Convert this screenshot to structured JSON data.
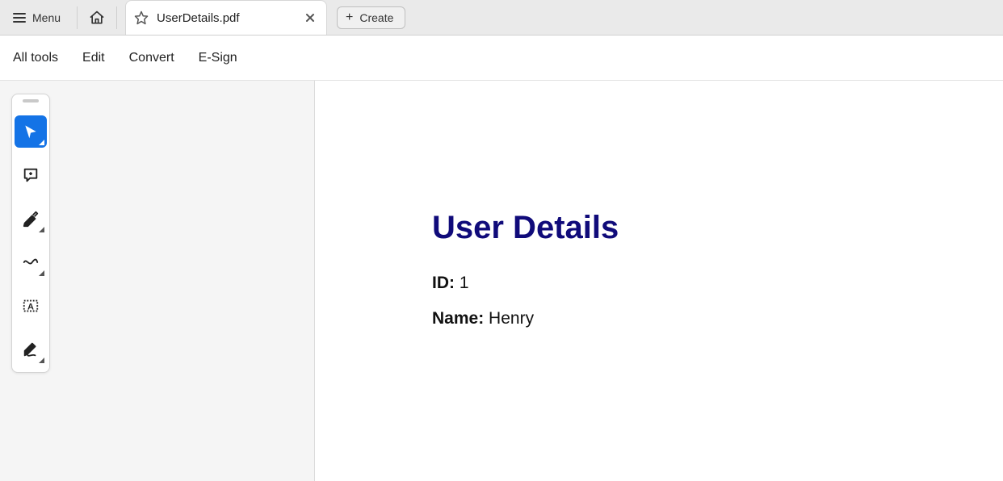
{
  "topbar": {
    "menu_label": "Menu",
    "tab_title": "UserDetails.pdf",
    "create_label": "Create"
  },
  "tools_menu": {
    "all_tools": "All tools",
    "edit": "Edit",
    "convert": "Convert",
    "esign": "E-Sign"
  },
  "palette": {
    "tools": [
      {
        "name": "select-tool",
        "selected": true
      },
      {
        "name": "comment-tool",
        "selected": false
      },
      {
        "name": "highlight-tool",
        "selected": false
      },
      {
        "name": "draw-tool",
        "selected": false
      },
      {
        "name": "textbox-tool",
        "selected": false
      },
      {
        "name": "sign-tool",
        "selected": false
      }
    ]
  },
  "document": {
    "title": "User Details",
    "fields": {
      "id_label": "ID:",
      "id_value": "1",
      "name_label": "Name:",
      "name_value": "Henry"
    }
  }
}
